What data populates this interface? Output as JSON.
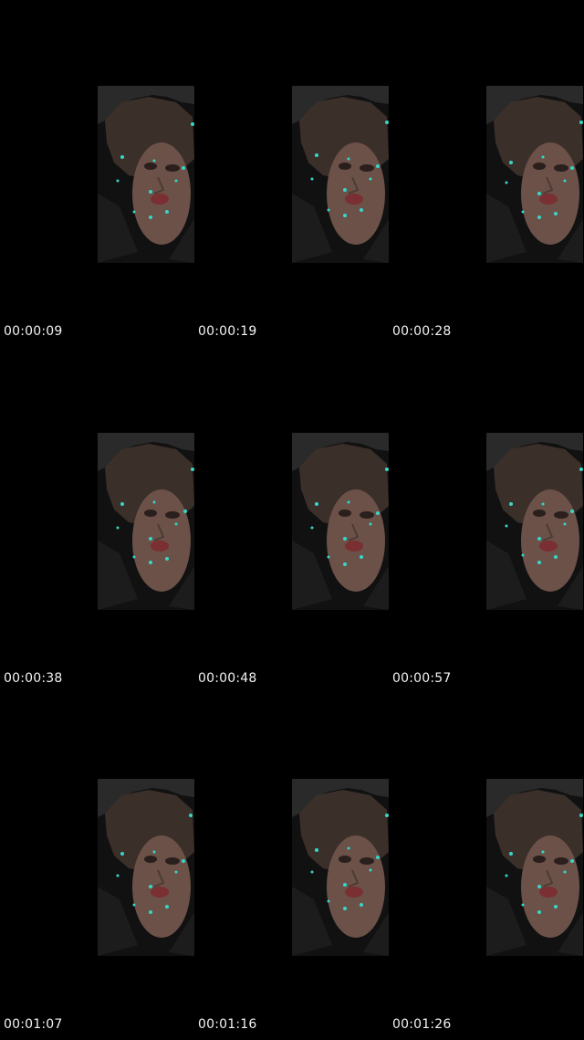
{
  "frames": [
    {
      "timestamp": "00:00:09"
    },
    {
      "timestamp": "00:00:19"
    },
    {
      "timestamp": "00:00:28"
    },
    {
      "timestamp": "00:00:38"
    },
    {
      "timestamp": "00:00:48"
    },
    {
      "timestamp": "00:00:57"
    },
    {
      "timestamp": "00:01:07"
    },
    {
      "timestamp": "00:01:16"
    },
    {
      "timestamp": "00:01:26"
    }
  ],
  "colors": {
    "background": "#000000",
    "timestamp_text": "#f2f2f2",
    "landmark_dot": "#37d6c8"
  }
}
